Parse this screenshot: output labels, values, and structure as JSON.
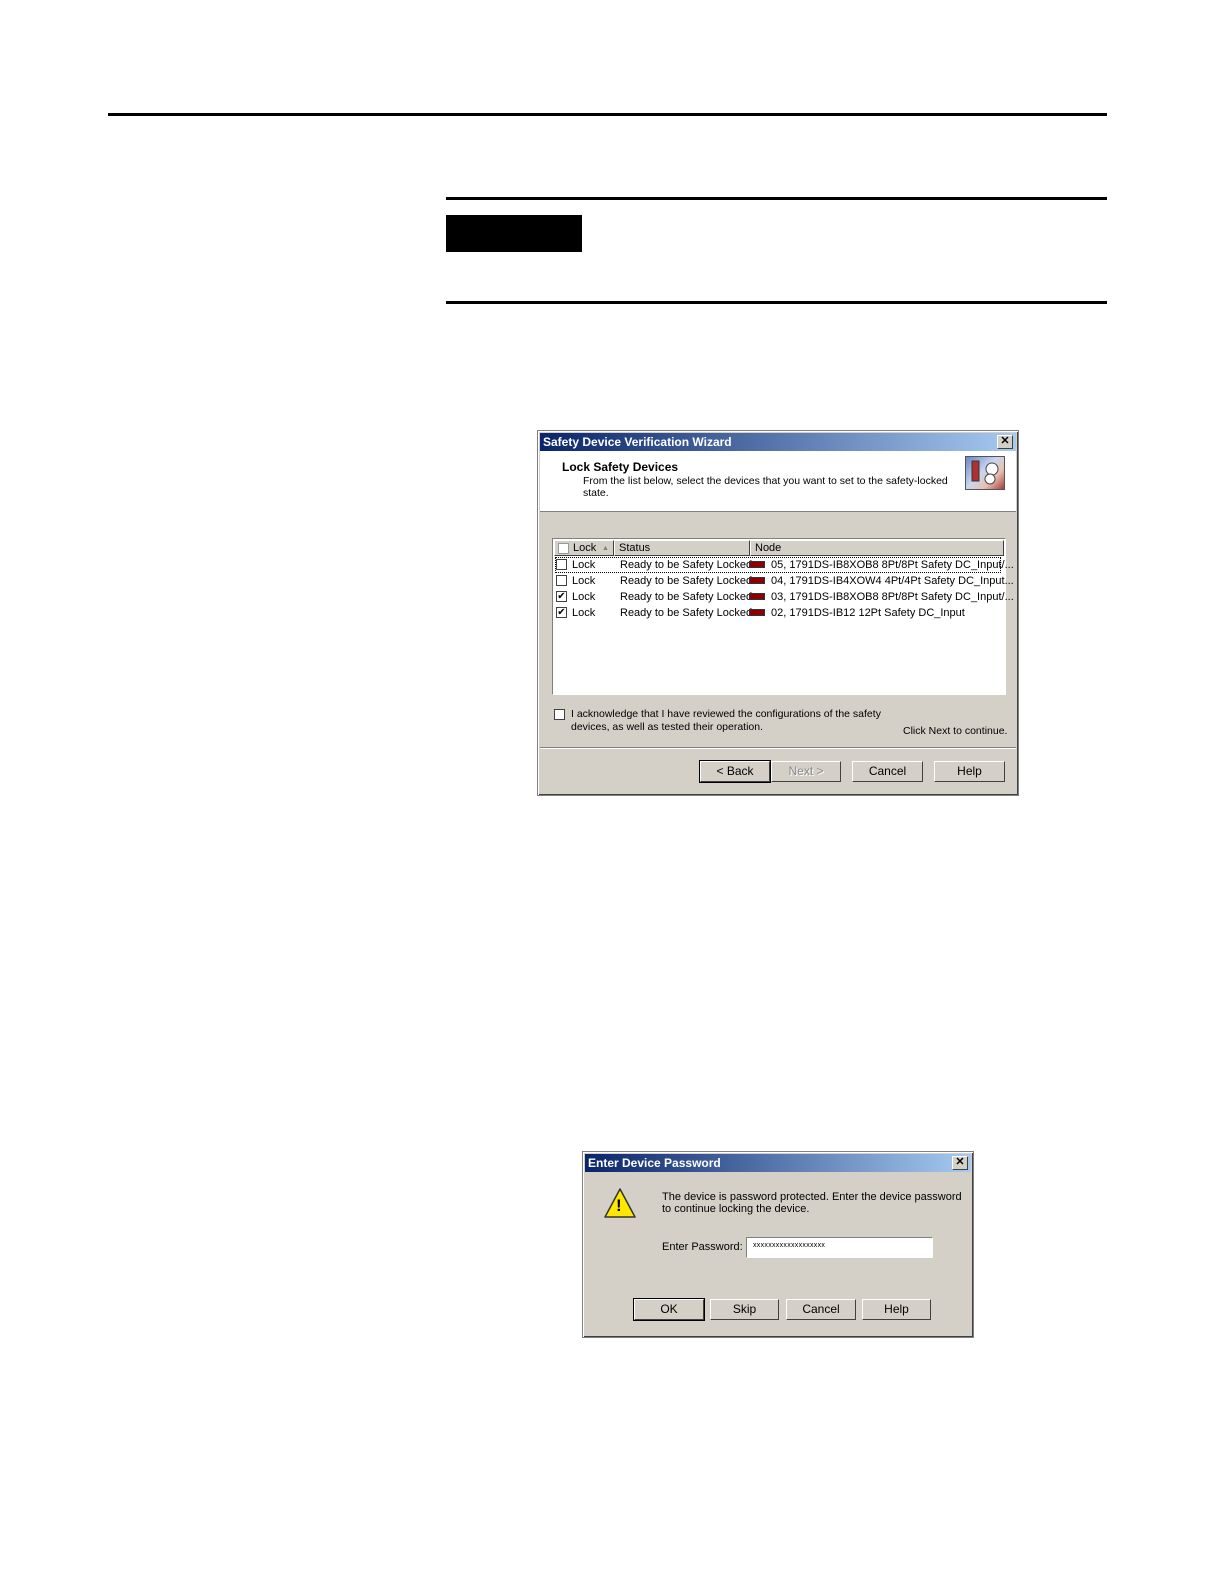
{
  "wizard": {
    "title": "Safety Device Verification Wizard",
    "close_glyph": "✕",
    "heading": "Lock Safety Devices",
    "description_line1": "From the list below, select the devices that you want to set to the safety-locked",
    "description_line2": "state.",
    "columns": {
      "lock": "Lock",
      "sort_glyph": "▲",
      "status": "Status",
      "node": "Node"
    },
    "rows": [
      {
        "checked": false,
        "lock": "Lock",
        "status": "Ready to be Safety Locked",
        "node": "05, 1791DS-IB8XOB8 8Pt/8Pt Safety DC_Input/..."
      },
      {
        "checked": false,
        "lock": "Lock",
        "status": "Ready to be Safety Locked",
        "node": "04, 1791DS-IB4XOW4 4Pt/4Pt Safety DC_Input..."
      },
      {
        "checked": true,
        "lock": "Lock",
        "status": "Ready to be Safety Locked",
        "node": "03, 1791DS-IB8XOB8 8Pt/8Pt Safety DC_Input/..."
      },
      {
        "checked": true,
        "lock": "Lock",
        "status": "Ready to be Safety Locked",
        "node": "02, 1791DS-IB12 12Pt Safety DC_Input"
      }
    ],
    "acknowledge_line1": "I acknowledge that I have reviewed the configurations of the safety",
    "acknowledge_line2": "devices, as well as tested their operation.",
    "next_hint": "Click Next to continue.",
    "buttons": {
      "back": "< Back",
      "next": "Next >",
      "cancel": "Cancel",
      "help": "Help"
    },
    "check_glyph": "✔"
  },
  "password_dialog": {
    "title": "Enter Device Password",
    "close_glyph": "✕",
    "warning_glyph": "!",
    "message_line1": "The device is password protected.  Enter the device password",
    "message_line2": "to continue locking the device.",
    "field_label": "Enter Password:",
    "field_value": "xxxxxxxxxxxxxxxxxxx",
    "buttons": {
      "ok": "OK",
      "skip": "Skip",
      "cancel": "Cancel",
      "help": "Help"
    }
  }
}
